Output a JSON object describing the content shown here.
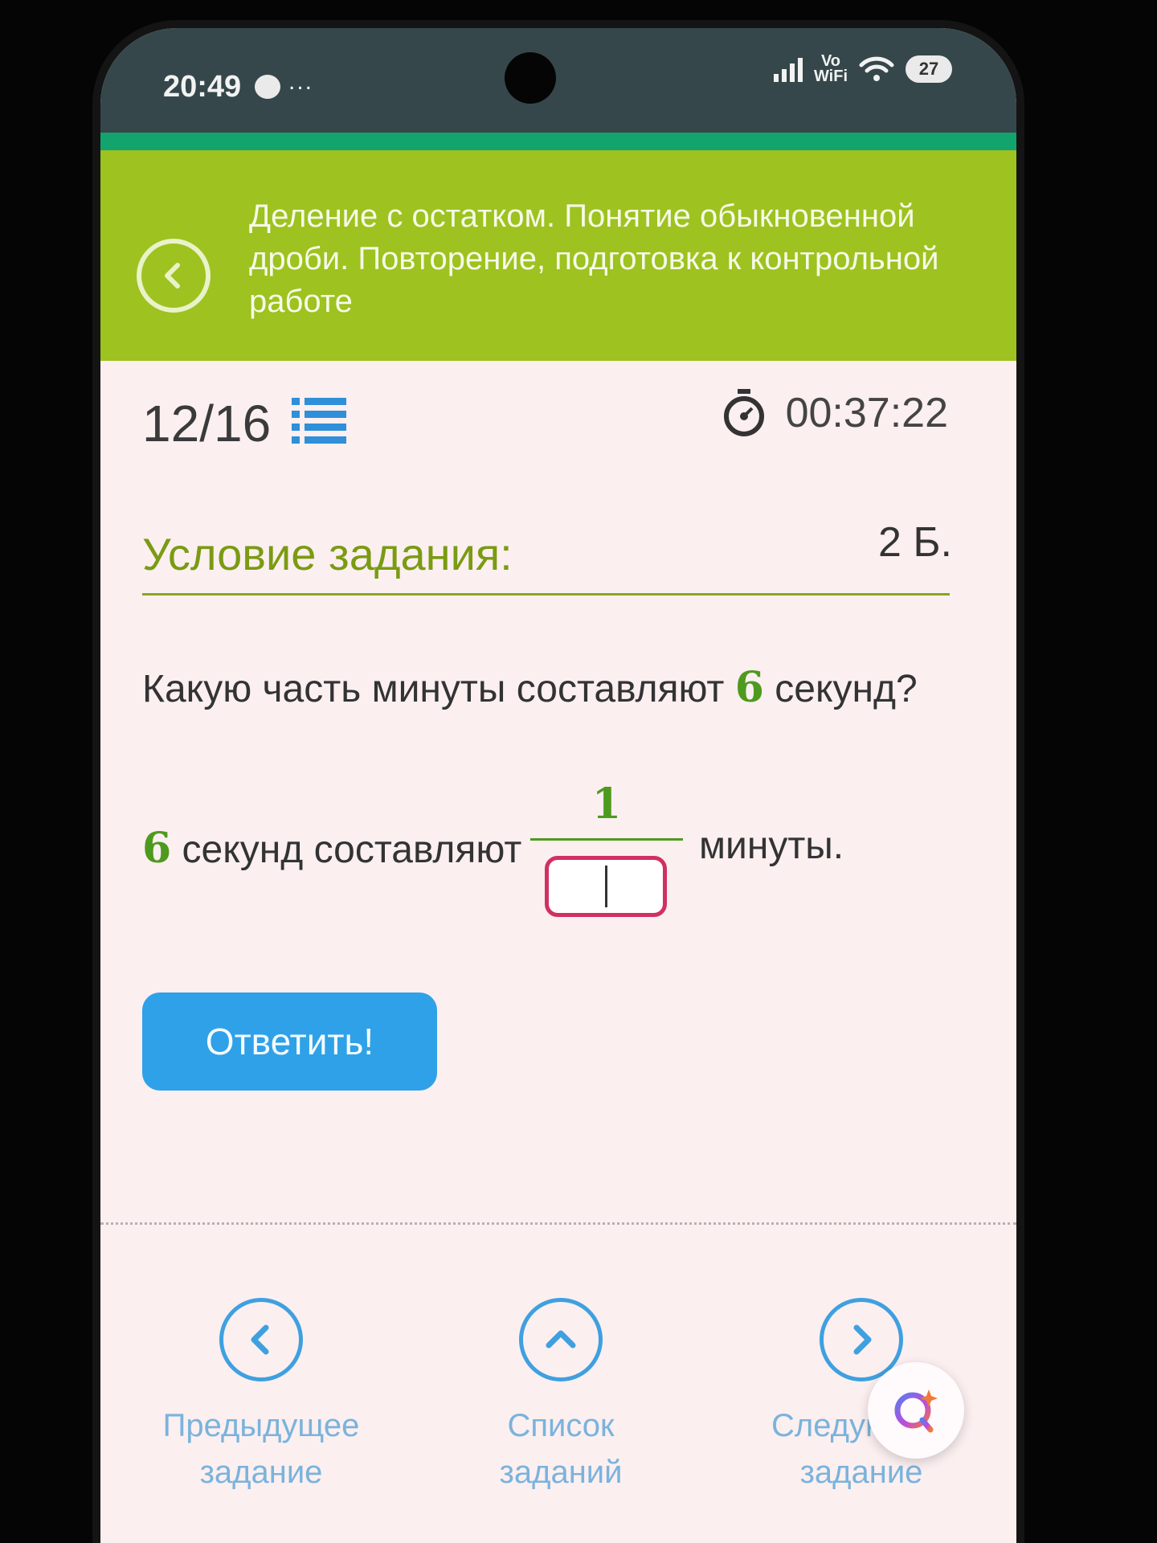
{
  "status_bar": {
    "time": "20:49",
    "more": "...",
    "vowifi_top": "Vo",
    "vowifi_bottom": "WiFi",
    "battery": "27"
  },
  "header": {
    "title": "Деление с остатком. Понятие обыкновенной дроби. Повторение, подготовка к контрольной работе"
  },
  "task": {
    "counter": "12/16",
    "timer": "00:37:22",
    "condition_title": "Условие задания:",
    "points": "2 Б.",
    "question_before": "Какую часть минуты составляют ",
    "question_number": "6",
    "question_after": " секунд?",
    "answer_number": "6",
    "answer_text": " секунд составляют",
    "fraction_numerator": "1",
    "fraction_denominator_value": "",
    "answer_tail": "минуты."
  },
  "submit_label": "Ответить!",
  "bottom_nav": {
    "prev_line1": "Предыдущее",
    "prev_line2": "задание",
    "list_line1": "Список",
    "list_line2": "заданий",
    "next_line1": "Следующее",
    "next_line2": "задание"
  },
  "colors": {
    "header_bg": "#9ec21f",
    "status_bg": "#35474a",
    "accent_strip": "#13a46e",
    "green_text": "#7a9b12",
    "number_green": "#4e9a1f",
    "input_border": "#d03062",
    "submit_bg": "#2fa1e8",
    "nav_blue": "#3fa0e0"
  }
}
